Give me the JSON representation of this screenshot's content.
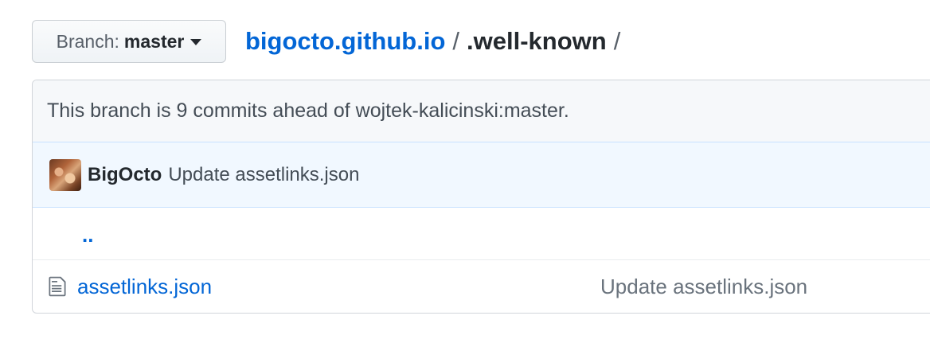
{
  "branch_selector": {
    "prefix": "Branch:",
    "name": "master"
  },
  "breadcrumb": {
    "repo": "bigocto.github.io",
    "separator": "/",
    "directory": ".well-known",
    "trailing_separator": "/"
  },
  "ahead_notice": "This branch is 9 commits ahead of wojtek-kalicinski:master.",
  "latest_commit": {
    "author": "BigOcto",
    "message": "Update assetlinks.json"
  },
  "parent_dir_label": "..",
  "files": [
    {
      "name": "assetlinks.json",
      "commit_message": "Update assetlinks.json",
      "icon": "file-icon"
    }
  ],
  "colors": {
    "link": "#0366d6",
    "commit_bg": "#f1f8ff",
    "notice_bg": "#f6f8fa"
  }
}
